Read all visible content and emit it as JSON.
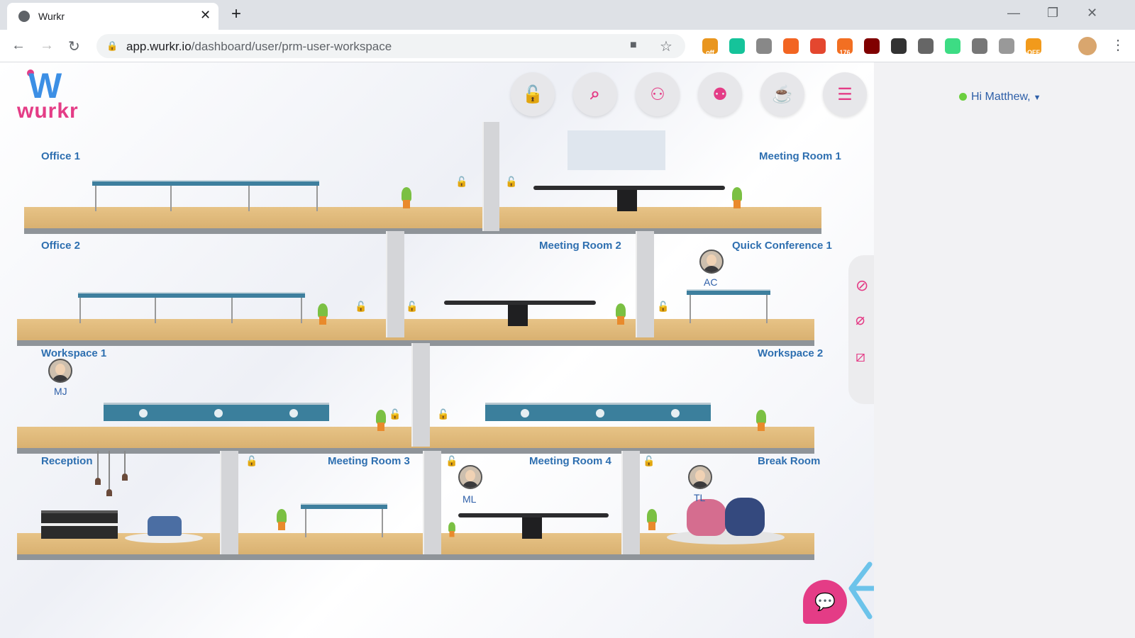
{
  "browser": {
    "tab_title": "Wurkr",
    "tab_close": "✕",
    "new_tab": "+",
    "url_host": "app.wurkr.io",
    "url_path": "/dashboard/user/prm-user-workspace",
    "window_controls": [
      "—",
      "❐",
      "✕"
    ],
    "extensions": [
      {
        "icon": "coupon-icon",
        "color": "#e9961f",
        "badge": "off"
      },
      {
        "icon": "grammarly-icon",
        "color": "#15c39a",
        "badge": ""
      },
      {
        "icon": "clipboard-icon",
        "color": "#888888",
        "badge": ""
      },
      {
        "icon": "fox-icon",
        "color": "#f26522",
        "badge": ""
      },
      {
        "icon": "lighthouse-icon",
        "color": "#e4472f",
        "badge": ""
      },
      {
        "icon": "mail-counter-icon",
        "color": "#f26f22",
        "badge": "176"
      },
      {
        "icon": "ublock-icon",
        "color": "#800000",
        "badge": ""
      },
      {
        "icon": "monitor-icon",
        "color": "#333333",
        "badge": ""
      },
      {
        "icon": "rocket-icon",
        "color": "#666666",
        "badge": ""
      },
      {
        "icon": "android-icon",
        "color": "#3ddc84",
        "badge": ""
      },
      {
        "icon": "drive-icon",
        "color": "#777777",
        "badge": ""
      },
      {
        "icon": "briefcase-icon",
        "color": "#999999",
        "badge": ""
      },
      {
        "icon": "sale-icon",
        "color": "#f29a1b",
        "badge": "OFF"
      }
    ]
  },
  "app": {
    "logo_text": "wurkr",
    "greeting": "Hi Matthew,",
    "top_buttons": [
      {
        "name": "unlock-icon",
        "glyph": "🔓"
      },
      {
        "name": "search-icon",
        "glyph": "🔍"
      },
      {
        "name": "add-user-icon",
        "glyph": "👤+"
      },
      {
        "name": "group-icon",
        "glyph": "👥"
      },
      {
        "name": "coffee-icon",
        "glyph": "☕"
      },
      {
        "name": "menu-icon",
        "glyph": "≡"
      }
    ],
    "rooms": {
      "office1": "Office 1",
      "meeting1": "Meeting Room 1",
      "office2": "Office 2",
      "meeting2": "Meeting Room 2",
      "quick1": "Quick Conference 1",
      "workspace1": "Workspace 1",
      "workspace2": "Workspace 2",
      "reception": "Reception",
      "meeting3": "Meeting Room 3",
      "meeting4": "Meeting Room 4",
      "breakroom": "Break Room"
    },
    "users": {
      "ac": "AC",
      "mj": "MJ",
      "ml": "ML",
      "tl": "TL"
    },
    "media": [
      "video-off-icon",
      "mic-off-icon",
      "screen-share-off-icon"
    ],
    "accent": "#e43c86",
    "room_label_color": "#2e6fb0"
  }
}
